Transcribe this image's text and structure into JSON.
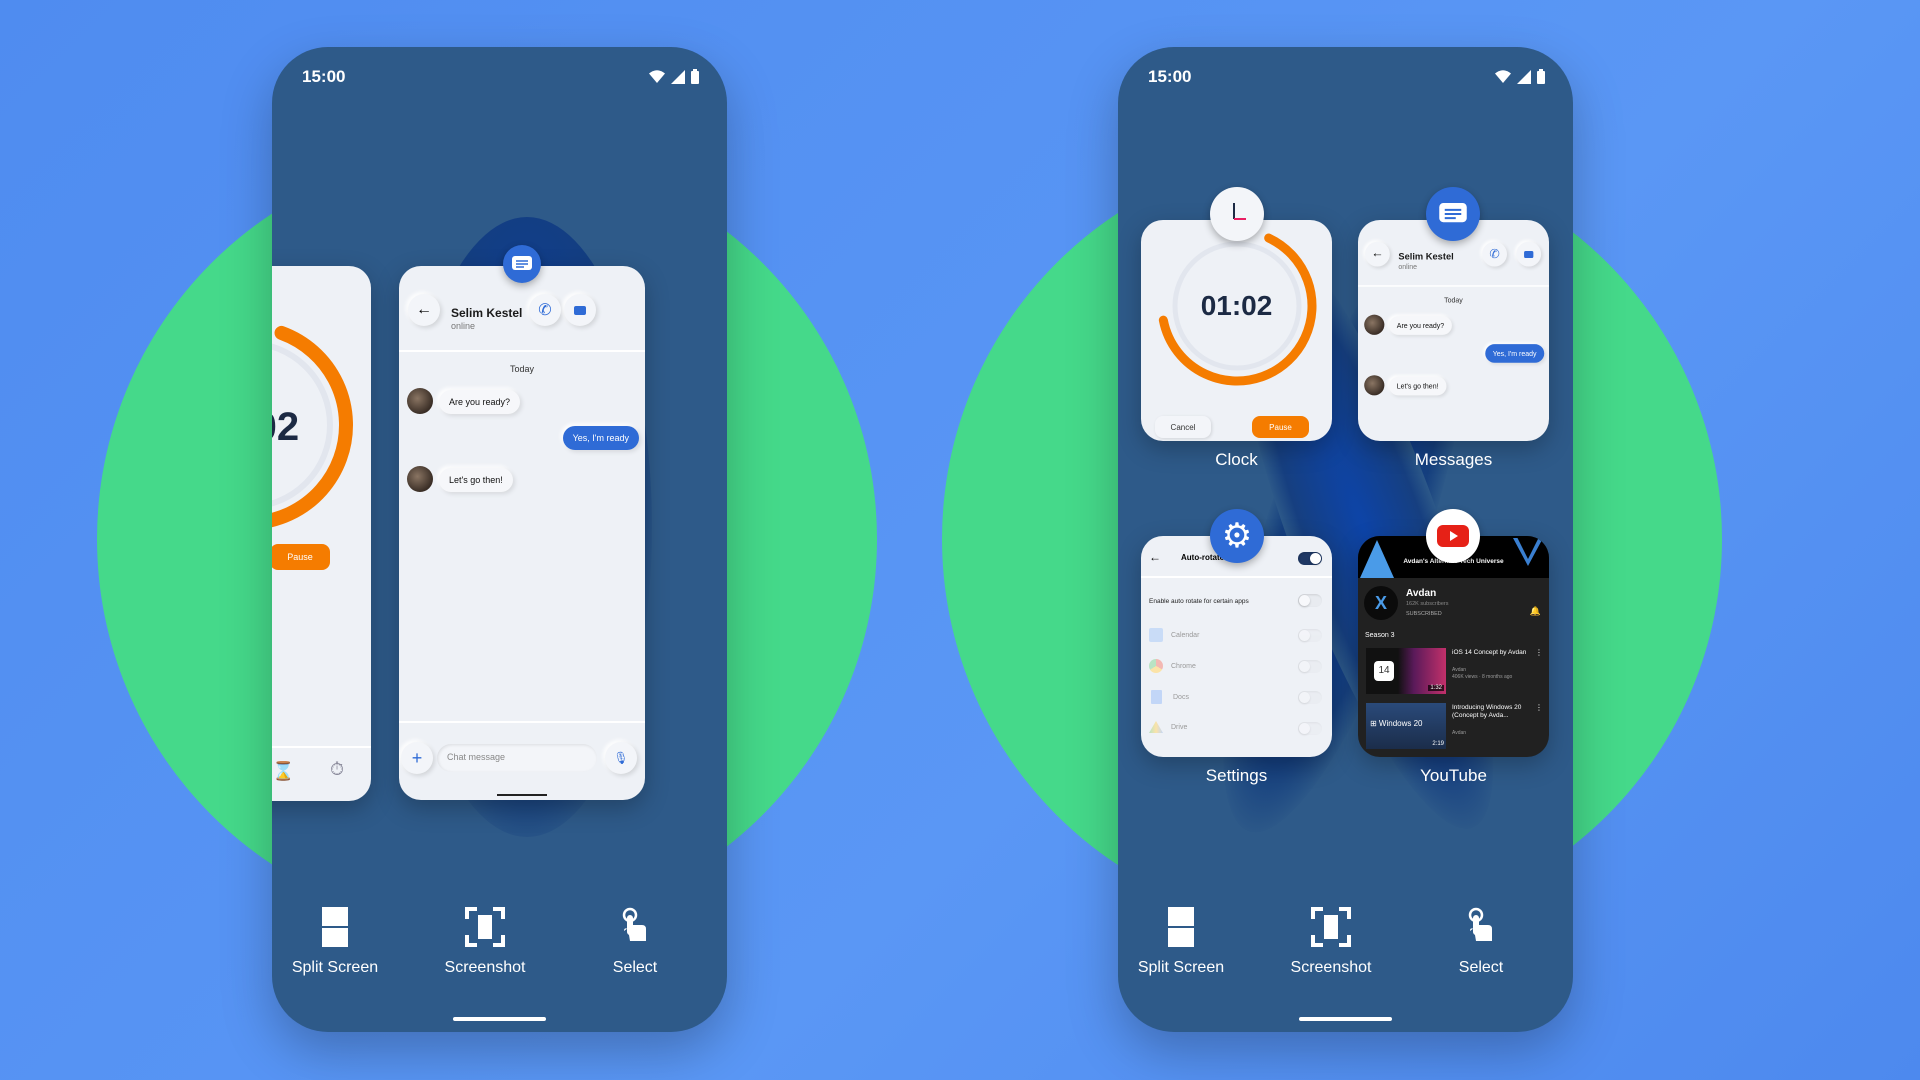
{
  "status": {
    "time": "15:00",
    "icons": [
      "wifi-icon",
      "signal-icon",
      "battery-icon"
    ]
  },
  "actions": [
    {
      "label": "Split Screen",
      "icon": "split-screen-icon"
    },
    {
      "label": "Screenshot",
      "icon": "screenshot-icon"
    },
    {
      "label": "Select",
      "icon": "select-hand-icon"
    }
  ],
  "messages": {
    "app_label": "Messages",
    "contact": "Selim Kestel",
    "presence": "online",
    "day": "Today",
    "thread": [
      "Are you ready?",
      "Yes, I'm ready",
      "Let's go then!"
    ],
    "input_placeholder": "Chat message"
  },
  "clock": {
    "app_label": "Clock",
    "timer": "01:02",
    "timer_partial": "2",
    "cancel": "Cancel",
    "pause": "Pause",
    "ring_progress": 0.65
  },
  "settings": {
    "app_label": "Settings",
    "title": "Auto-rotate",
    "auto_rotate_on": true,
    "option": "Enable auto rotate for certain apps",
    "apps": [
      "Calendar",
      "Chrome",
      "Docs",
      "Drive"
    ]
  },
  "youtube": {
    "app_label": "YouTube",
    "banner": "Avdan's Alternate Tech Universe",
    "channel": "Avdan",
    "subscribers": "162K subscribers",
    "subscribed": "SUBSCRIBED",
    "section": "Season 3",
    "videos": [
      {
        "title": "iOS 14 Concept by Avdan",
        "channel": "Avdan",
        "meta": "406K views · 8 months ago",
        "thumb": "14",
        "duration": "1:32"
      },
      {
        "title": "Introducing Windows 20 (Concept by Avda...",
        "channel": "Avdan",
        "meta": "",
        "thumb": "Windows 20",
        "duration": "2:19"
      }
    ]
  },
  "colors": {
    "background": "#4f8cf0",
    "circle": "#45d98a",
    "phone": "#2e5a89",
    "accent_orange": "#f57c00",
    "accent_blue": "#2f6bd6"
  }
}
